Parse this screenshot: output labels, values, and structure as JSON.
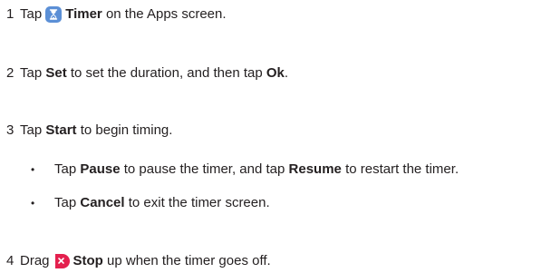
{
  "steps": [
    {
      "num": "1",
      "pre": "Tap",
      "icon": "hourglass-icon",
      "bold": "Timer",
      "post": "on the Apps screen."
    },
    {
      "num": "2",
      "pre": "Tap",
      "bold1": "Set",
      "mid": "to set the duration, and then tap",
      "bold2": "Ok",
      "post": "."
    },
    {
      "num": "3",
      "pre": "Tap",
      "bold": "Start",
      "post": "to begin timing."
    },
    {
      "num": "4",
      "pre": "Drag",
      "icon": "stop-icon",
      "bold": "Stop",
      "post": "up when the timer goes off."
    }
  ],
  "bullets": [
    {
      "mark": "•",
      "pre": "Tap",
      "bold1": "Pause",
      "mid": "to pause the timer, and tap",
      "bold2": "Resume",
      "post": "to restart the timer."
    },
    {
      "mark": "•",
      "pre": "Tap",
      "bold": "Cancel",
      "post": "to exit the timer screen."
    }
  ],
  "colors": {
    "text": "#231f20",
    "timer_icon_bg": "#5b8fd6",
    "stop_icon_bg": "#e4204e"
  }
}
